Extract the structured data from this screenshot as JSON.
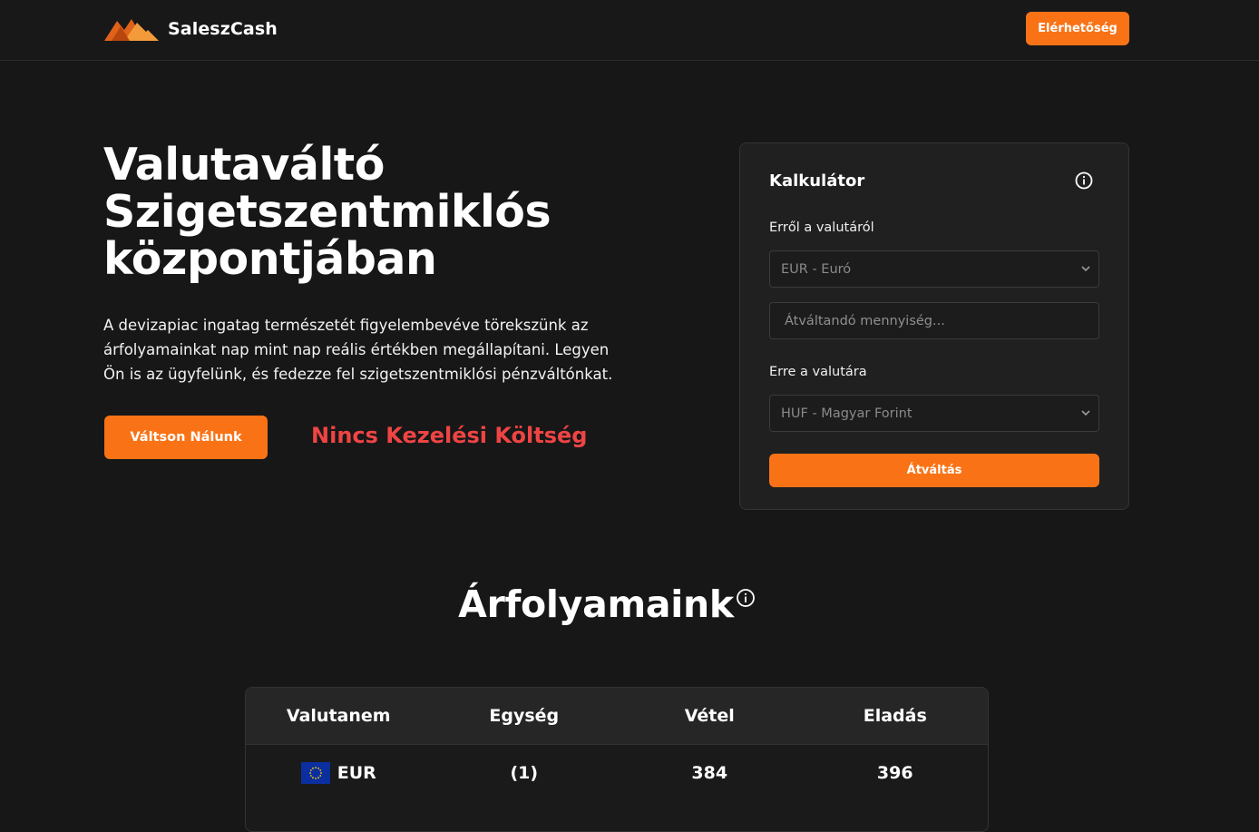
{
  "header": {
    "brand": "SaleszCash",
    "contact_label": "Elérhetőség"
  },
  "hero": {
    "title_lines": [
      "Valutaváltó",
      "Szigetszentmiklós",
      "központjában"
    ],
    "description": "A devizapiac ingatag természetét figyelembevéve törekszünk az árfolyamainkat nap mint nap reális értékben megállapítani. Legyen Ön is az ügyfelünk, és fedezze fel szigetszentmiklósi pénzváltónkat.",
    "cta_label": "Váltson Nálunk",
    "no_fee_text": "Nincs Kezelési Költség"
  },
  "calculator": {
    "title": "Kalkulátor",
    "from_label": "Erről a valutáról",
    "from_value": "EUR - Euró",
    "amount_placeholder": "Átváltandó mennyiség...",
    "to_label": "Erre a valutára",
    "to_value": "HUF - Magyar Forint",
    "convert_label": "Átváltás"
  },
  "rates": {
    "title": "Árfolyamaink",
    "columns": [
      "Valutanem",
      "Egység",
      "Vétel",
      "Eladás"
    ],
    "rows": [
      {
        "currency": "EUR",
        "unit": "(1)",
        "buy": "384",
        "sell": "396"
      }
    ]
  },
  "colors": {
    "accent": "#f97316",
    "background": "#171717",
    "highlight_text": "#ef4444"
  },
  "icons": {
    "logo": "mountain-logo-icon",
    "info": "info-circle-icon",
    "select": "chevron-down-icon",
    "flag": "eu-flag-icon"
  }
}
